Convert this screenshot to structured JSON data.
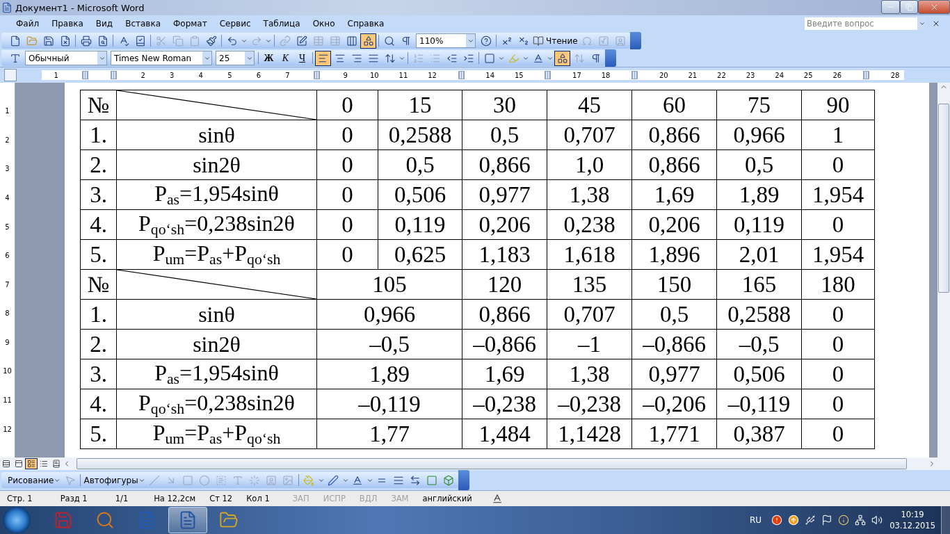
{
  "window": {
    "title": "Документ1 - Microsoft Word"
  },
  "menu": [
    "Файл",
    "Правка",
    "Вид",
    "Вставка",
    "Формат",
    "Сервис",
    "Таблица",
    "Окно",
    "Справка"
  ],
  "help_box": {
    "placeholder": "Введите вопрос"
  },
  "standard_toolbar": {
    "zoom": "110%",
    "reading": "Чтение",
    "drawing_toggle": {
      "selected": true
    }
  },
  "formatting_toolbar": {
    "style": "Обычный",
    "font": "Times New Roman",
    "size": "25",
    "font_buttons": [
      "Ж",
      "К",
      "Ч"
    ],
    "alignment": [
      {
        "selected": true
      },
      {
        "selected": false
      },
      {
        "selected": false
      },
      {
        "selected": false
      }
    ],
    "toggle": {
      "selected": true
    }
  },
  "ruler": {
    "marks": [
      {
        "kind": "number",
        "text": "1"
      },
      {
        "kind": "marker"
      },
      {
        "kind": "marker"
      },
      {
        "kind": "number",
        "text": "2"
      },
      {
        "kind": "number",
        "text": "3"
      },
      {
        "kind": "number",
        "text": "4"
      },
      {
        "kind": "number",
        "text": "5"
      },
      {
        "kind": "number",
        "text": "6"
      },
      {
        "kind": "number",
        "text": "7"
      },
      {
        "kind": "marker"
      },
      {
        "kind": "number",
        "text": "9"
      },
      {
        "kind": "number",
        "text": "10"
      },
      {
        "kind": "number",
        "text": "11"
      },
      {
        "kind": "number",
        "text": "12"
      },
      {
        "kind": "marker"
      },
      {
        "kind": "number",
        "text": "14"
      },
      {
        "kind": "number",
        "text": "15"
      },
      {
        "kind": "marker"
      },
      {
        "kind": "number",
        "text": "17"
      },
      {
        "kind": "number",
        "text": "18"
      },
      {
        "kind": "marker"
      },
      {
        "kind": "number",
        "text": "20"
      },
      {
        "kind": "number",
        "text": "21"
      },
      {
        "kind": "number",
        "text": "22"
      },
      {
        "kind": "number",
        "text": "23"
      },
      {
        "kind": "number",
        "text": "24"
      },
      {
        "kind": "number",
        "text": "25"
      },
      {
        "kind": "number",
        "text": "26"
      },
      {
        "kind": "marker"
      },
      {
        "kind": "number",
        "text": "28"
      }
    ]
  },
  "vertical_ruler": {
    "marks": [
      "1",
      "2",
      "3",
      "4",
      "5",
      "6",
      "7",
      "8",
      "9",
      "10",
      "11",
      "12"
    ]
  },
  "table": {
    "blocks": [
      {
        "header": [
          "№",
          "0",
          "15",
          "30",
          "45",
          "60",
          "75",
          "90"
        ],
        "rows": [
          {
            "num": "1.",
            "label": "sinθ",
            "values": [
              "0",
              "0,2588",
              "0,5",
              "0,707",
              "0,866",
              "0,966",
              "1"
            ]
          },
          {
            "num": "2.",
            "label": "sin2θ",
            "values": [
              "0",
              "0,5",
              "0,866",
              "1,0",
              "0,866",
              "0,5",
              "0"
            ]
          },
          {
            "num": "3.",
            "label": "P$_{as}$=1,954sinθ",
            "values": [
              "0",
              "0,506",
              "0,977",
              "1,38",
              "1,69",
              "1,89",
              "1,954"
            ]
          },
          {
            "num": "4.",
            "label": "P$_{qo‘sh}$=0,238sin2θ",
            "values": [
              "0",
              "0,119",
              "0,206",
              "0,238",
              "0,206",
              "0,119",
              "0"
            ]
          },
          {
            "num": "5.",
            "label": "P$_{um}$=P$_{as}$+P$_{qo‘sh}$",
            "values": [
              "0",
              "0,625",
              "1,183",
              "1,618",
              "1,896",
              "2,01",
              "1,954"
            ]
          }
        ]
      },
      {
        "header": [
          "№",
          "105",
          "120",
          "135",
          "150",
          "165",
          "180"
        ],
        "rows": [
          {
            "num": "1.",
            "label": "sinθ",
            "values": [
              "0,966",
              "0,866",
              "0,707",
              "0,5",
              "0,2588",
              "0"
            ]
          },
          {
            "num": "2.",
            "label": "sin2θ",
            "values": [
              "–0,5",
              "–0,866",
              "–1",
              "–0,866",
              "–0,5",
              "0"
            ]
          },
          {
            "num": "3.",
            "label": "P$_{as}$=1,954sinθ",
            "values": [
              "1,89",
              "1,69",
              "1,38",
              "0,977",
              "0,506",
              "0"
            ]
          },
          {
            "num": "4.",
            "label": "P$_{qo‘sh}$=0,238sin2θ",
            "values": [
              "–0,119",
              "–0,238",
              "–0,238",
              "–0,206",
              "–0,119",
              "0"
            ]
          },
          {
            "num": "5.",
            "label": "P$_{um}$=P$_{as}$+P$_{qo‘sh}$",
            "values": [
              "1,77",
              "1,484",
              "1,1428",
              "1,771",
              "0,387",
              "0"
            ]
          }
        ]
      }
    ]
  },
  "view_buttons": [
    {
      "selected": false
    },
    {
      "selected": false
    },
    {
      "selected": true
    },
    {
      "selected": false
    },
    {
      "selected": false
    }
  ],
  "drawing_toolbar": {
    "drawing": "Рисование",
    "autoshapes": "Автофигуры"
  },
  "status_bar": [
    {
      "text": "Стр. 1",
      "disabled": false
    },
    {
      "text": "Разд 1",
      "disabled": false
    },
    {
      "text": "1/1",
      "disabled": false
    },
    {
      "text": "На 12,2см",
      "disabled": false
    },
    {
      "text": "Ст 12",
      "disabled": false
    },
    {
      "text": "Кол 1",
      "disabled": false
    },
    {
      "text": "ЗАП",
      "disabled": true
    },
    {
      "text": "ИСПР",
      "disabled": true
    },
    {
      "text": "ВДЛ",
      "disabled": true
    },
    {
      "text": "ЗАМ",
      "disabled": true
    },
    {
      "text": "английский",
      "disabled": false
    }
  ],
  "taskbar": {
    "apps": [
      {
        "selected": false
      },
      {
        "selected": false
      },
      {
        "selected": false
      },
      {
        "selected": true
      },
      {
        "selected": false
      }
    ],
    "language": "RU",
    "time": "10:19",
    "date": "03.12.2015"
  }
}
